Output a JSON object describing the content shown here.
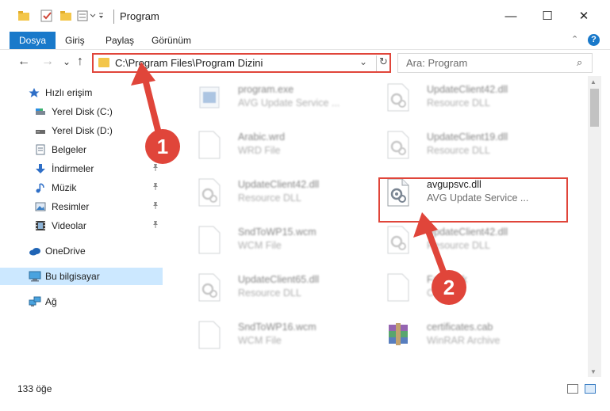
{
  "window": {
    "title": "Program",
    "minimize_glyph": "—",
    "maximize_glyph": "☐",
    "close_glyph": "✕"
  },
  "ribbon": {
    "tabs": [
      "Dosya",
      "Giriş",
      "Paylaş",
      "Görünüm"
    ],
    "help_label": "?",
    "collapse_glyph": "⌃"
  },
  "address": {
    "path": "C:\\Program Files\\Program Dizini",
    "dropdown_glyph": "⌄",
    "refresh_glyph": "↻"
  },
  "search": {
    "placeholder": "Ara: Program",
    "icon_glyph": "⌕"
  },
  "nav_buttons": {
    "back": "←",
    "forward": "→",
    "recent": "⌄",
    "up": "↑"
  },
  "sidebar": {
    "items": [
      {
        "label": "Hızlı erişim",
        "icon": "star-icon",
        "pinned": false
      },
      {
        "label": "Yerel Disk (C:)",
        "icon": "drive-icon",
        "pinned": false
      },
      {
        "label": "Yerel Disk (D:)",
        "icon": "drive-icon",
        "pinned": false
      },
      {
        "label": "Belgeler",
        "icon": "documents-icon",
        "pinned": false
      },
      {
        "label": "İndirmeler",
        "icon": "download-icon",
        "pinned": true
      },
      {
        "label": "Müzik",
        "icon": "music-icon",
        "pinned": true
      },
      {
        "label": "Resimler",
        "icon": "pictures-icon",
        "pinned": true
      },
      {
        "label": "Videolar",
        "icon": "video-icon",
        "pinned": true
      },
      {
        "label": "OneDrive",
        "icon": "cloud-icon",
        "pinned": false
      },
      {
        "label": "Bu bilgisayar",
        "icon": "computer-icon",
        "pinned": false,
        "selected": true
      },
      {
        "label": "Ağ",
        "icon": "network-icon",
        "pinned": false
      }
    ],
    "pin_glyph": "📌"
  },
  "files": [
    {
      "name": "program.exe",
      "desc": "AVG Update Service ...",
      "icon": "exe-icon",
      "faded": true
    },
    {
      "name": "UpdateClient42.dll",
      "desc": "Resource DLL",
      "icon": "dll-icon",
      "faded": true
    },
    {
      "name": "Arabic.wrd",
      "desc": "WRD File",
      "icon": "file-icon",
      "faded": true
    },
    {
      "name": "UpdateClient19.dll",
      "desc": "Resource DLL",
      "icon": "dll-icon",
      "faded": true
    },
    {
      "name": "UpdateClient42.dll",
      "desc": "Resource DLL",
      "icon": "dll-icon",
      "faded": true
    },
    {
      "name": "avgupsvc.dll",
      "desc": "AVG Update Service ...",
      "icon": "dll-icon",
      "faded": false,
      "highlighted": true
    },
    {
      "name": "SndToWP15.wcm",
      "desc": "WCM File",
      "icon": "file-icon",
      "faded": true
    },
    {
      "name": "UpdateClient42.dll",
      "desc": "Resource DLL",
      "icon": "dll-icon",
      "faded": true
    },
    {
      "name": "UpdateClient65.dll",
      "desc": "Resource DLL",
      "icon": "dll-icon",
      "faded": true
    },
    {
      "name": "Fast....ck",
      "desc": "CK...",
      "icon": "file-icon",
      "faded": true
    },
    {
      "name": "SndToWP16.wcm",
      "desc": "WCM File",
      "icon": "file-icon",
      "faded": true
    },
    {
      "name": "certificates.cab",
      "desc": "WinRAR Archive",
      "icon": "winrar-icon",
      "faded": true
    }
  ],
  "status": {
    "item_count": "133 öğe"
  },
  "annotations": {
    "step1": "1",
    "step2": "2"
  },
  "colors": {
    "accent": "#1979ca",
    "highlight": "#e0453a",
    "selection": "#cce8ff"
  }
}
